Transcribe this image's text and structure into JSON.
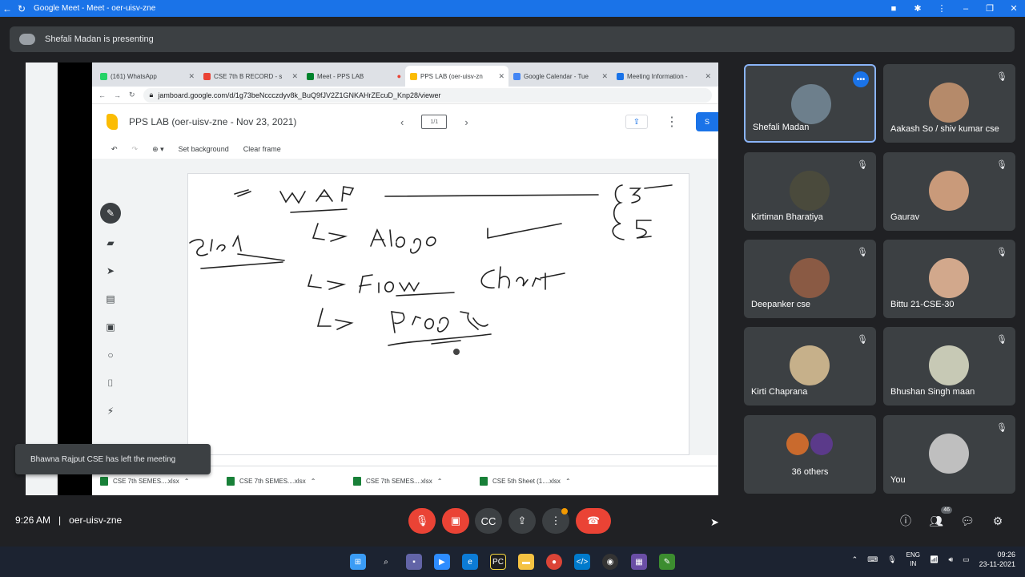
{
  "window": {
    "title": "Google Meet - Meet - oer-uisv-zne"
  },
  "presenting": {
    "text": "Shefali Madan is presenting"
  },
  "browser": {
    "tabs": [
      {
        "label": "(161) WhatsApp",
        "color": "#25d366"
      },
      {
        "label": "CSE 7th B RECORD - s",
        "color": "#ea4335"
      },
      {
        "label": "Meet - PPS LAB",
        "color": "#00832d"
      },
      {
        "label": "PPS LAB (oer-uisv-zn",
        "color": "#fbbc04",
        "active": true
      },
      {
        "label": "Google Calendar - Tue",
        "color": "#4285f4"
      },
      {
        "label": "Meeting Information -",
        "color": "#1a73e8"
      }
    ],
    "url": "jamboard.google.com/d/1g73beNccczdyv8k_BuQ9fJV2Z1GNKAHrZEcuD_Knp28/viewer"
  },
  "jamboard": {
    "title": "PPS LAB (oer-uisv-zne - Nov 23, 2021)",
    "frame_indicator": "1/1",
    "set_background": "Set background",
    "clear_frame": "Clear frame",
    "share_label": "S"
  },
  "downloads": [
    "CSE 7th SEMES....xlsx",
    "CSE 7th SEMES....xlsx",
    "CSE 7th SEMES....xlsx",
    "CSE 5th Sheet (1....xlsx"
  ],
  "toast": {
    "text": "Bhawna Rajput CSE has left the meeting"
  },
  "participants": [
    {
      "name": "Shefali Madan",
      "color": "#6d7f8c"
    },
    {
      "name": "Aakash So / shiv kumar cse",
      "color": "#b58a6a"
    },
    {
      "name": "Kirtiman Bharatiya",
      "color": "#4a4a3c"
    },
    {
      "name": "Gaurav",
      "color": "#c99a7a"
    },
    {
      "name": "Deepanker cse",
      "color": "#8a5a44"
    },
    {
      "name": "Bittu 21-CSE-30",
      "color": "#d2a88c"
    },
    {
      "name": "Kirti Chaprana",
      "color": "#c6b08a"
    },
    {
      "name": "Bhushan Singh maan",
      "color": "#c7c9b5"
    },
    {
      "name": "36 others",
      "color": "#c96a2d"
    },
    {
      "name": "You",
      "color": "#bfbfbf"
    }
  ],
  "controls": {
    "time": "9:26 AM",
    "separator": "|",
    "meeting_code": "oer-uisv-zne",
    "people_count": "46"
  },
  "taskbar": {
    "lang_top": "ENG",
    "lang_bottom": "IN",
    "clock_time": "09:26",
    "clock_date": "23-11-2021"
  }
}
